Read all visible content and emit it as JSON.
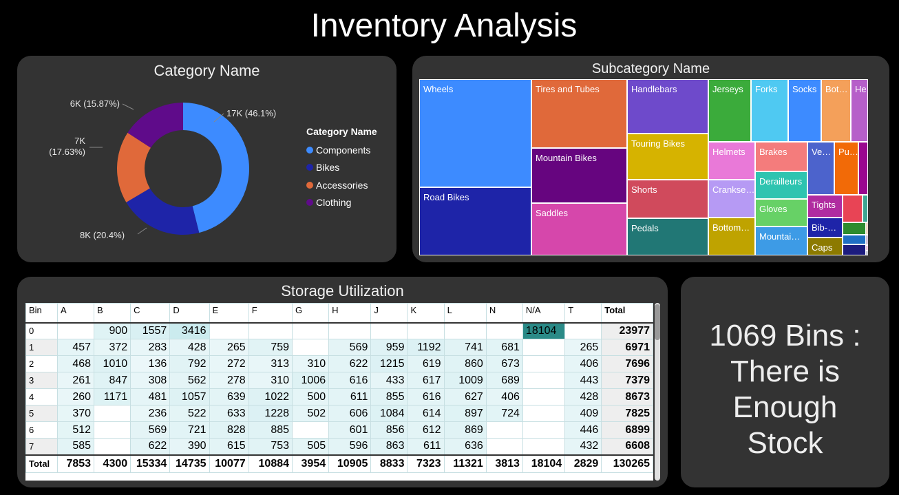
{
  "page": {
    "title": "Inventory Analysis"
  },
  "category_panel": {
    "title": "Category Name",
    "legend_title": "Category Name",
    "legend": [
      {
        "label": "Components",
        "color": "#3D8BFF"
      },
      {
        "label": "Bikes",
        "color": "#1E24A8"
      },
      {
        "label": "Accessories",
        "color": "#E0693A"
      },
      {
        "label": "Clothing",
        "color": "#5F0B8A"
      }
    ]
  },
  "chart_data": {
    "type": "pie",
    "title": "Category Name",
    "slices": [
      {
        "label": "Components",
        "value": 17,
        "percent": 46.1,
        "data_label": "17K (46.1%)",
        "color": "#3D8BFF"
      },
      {
        "label": "Bikes",
        "value": 8,
        "percent": 20.4,
        "data_label": "8K (20.4%)",
        "color": "#1E24A8"
      },
      {
        "label": "Accessories",
        "value": 7,
        "percent": 17.63,
        "data_label_lines": [
          "7K",
          "(17.63%)"
        ],
        "color": "#E0693A"
      },
      {
        "label": "Clothing",
        "value": 6,
        "percent": 15.87,
        "data_label": "6K (15.87%)",
        "color": "#5F0B8A"
      }
    ],
    "legend_position": "right"
  },
  "subcategory_panel": {
    "title": "Subcategory Name",
    "tiles": [
      {
        "id": "wheels",
        "label": "Wheels",
        "color": "#3D8BFF"
      },
      {
        "id": "road-bikes",
        "label": "Road Bikes",
        "color": "#1E24A8"
      },
      {
        "id": "tires",
        "label": "Tires and Tubes",
        "color": "#E0693A"
      },
      {
        "id": "mountain-bikes",
        "label": "Mountain Bikes",
        "color": "#66057F"
      },
      {
        "id": "saddles",
        "label": "Saddles",
        "color": "#D647AB"
      },
      {
        "id": "handlebars",
        "label": "Handlebars",
        "color": "#6E4ACB"
      },
      {
        "id": "touring-bikes",
        "label": "Touring Bikes",
        "color": "#D6B300"
      },
      {
        "id": "shorts",
        "label": "Shorts",
        "color": "#D04A5C"
      },
      {
        "id": "pedals",
        "label": "Pedals",
        "color": "#217775"
      },
      {
        "id": "jerseys",
        "label": "Jerseys",
        "color": "#3BAB3B"
      },
      {
        "id": "forks",
        "label": "Forks",
        "color": "#4FC9F2"
      },
      {
        "id": "socks",
        "label": "Socks",
        "color": "#3D8BFF"
      },
      {
        "id": "bottles",
        "label": "Bot…",
        "color": "#F4A05A"
      },
      {
        "id": "headsets",
        "label": "He…",
        "color": "#B65FC9"
      },
      {
        "id": "helmets",
        "label": "Helmets",
        "color": "#E979D8"
      },
      {
        "id": "cranksets",
        "label": "Crankse…",
        "color": "#B69AF4"
      },
      {
        "id": "bottom-brackets",
        "label": "Bottom…",
        "color": "#BFA300"
      },
      {
        "id": "brakes",
        "label": "Brakes",
        "color": "#F47C7C"
      },
      {
        "id": "derailleurs",
        "label": "Derailleurs",
        "color": "#2EC4B0"
      },
      {
        "id": "gloves",
        "label": "Gloves",
        "color": "#67D166"
      },
      {
        "id": "mountain-frames",
        "label": "Mountai…",
        "color": "#3D9BE6"
      },
      {
        "id": "vests",
        "label": "Ve…",
        "color": "#4C63CC"
      },
      {
        "id": "pumps",
        "label": "Pu…",
        "color": "#F26A07"
      },
      {
        "id": "purple-small",
        "label": "",
        "color": "#9A078F"
      },
      {
        "id": "tights",
        "label": "Tights",
        "color": "#B02CA0"
      },
      {
        "id": "bib-shorts",
        "label": "Bib-…",
        "color": "#1E24A8"
      },
      {
        "id": "caps",
        "label": "Caps",
        "color": "#8C7A00"
      },
      {
        "id": "red-small",
        "label": "",
        "color": "#E84455"
      },
      {
        "id": "teal-small",
        "label": "",
        "color": "#3EA592"
      },
      {
        "id": "green-small",
        "label": "",
        "color": "#2E8B2E"
      },
      {
        "id": "orange-small",
        "label": "",
        "color": "#D06020"
      },
      {
        "id": "blue-small",
        "label": "",
        "color": "#1F6FC4"
      },
      {
        "id": "navy-small",
        "label": "",
        "color": "#1C1C7E"
      },
      {
        "id": "purple-tiny",
        "label": "",
        "color": "#55126C"
      },
      {
        "id": "pink-tiny",
        "label": "",
        "color": "#C4277E"
      },
      {
        "id": "dark-tiny",
        "label": "",
        "color": "#122B4F"
      }
    ]
  },
  "storage": {
    "title": "Storage Utilization",
    "columns": [
      "Bin",
      "A",
      "B",
      "C",
      "D",
      "E",
      "F",
      "G",
      "H",
      "J",
      "K",
      "L",
      "N",
      "N/A",
      "T",
      "Total"
    ],
    "rows": [
      [
        "0",
        "",
        "900",
        "1557",
        "3416",
        "",
        "",
        "",
        "",
        "",
        "",
        "",
        "",
        "18104",
        "",
        "23977"
      ],
      [
        "1",
        "457",
        "372",
        "283",
        "428",
        "265",
        "759",
        "",
        "569",
        "959",
        "1192",
        "741",
        "681",
        "",
        "265",
        "6971"
      ],
      [
        "2",
        "468",
        "1010",
        "136",
        "792",
        "272",
        "313",
        "310",
        "622",
        "1215",
        "619",
        "860",
        "673",
        "",
        "406",
        "7696"
      ],
      [
        "3",
        "261",
        "847",
        "308",
        "562",
        "278",
        "310",
        "1006",
        "616",
        "433",
        "617",
        "1009",
        "689",
        "",
        "443",
        "7379"
      ],
      [
        "4",
        "260",
        "1171",
        "481",
        "1057",
        "639",
        "1022",
        "500",
        "611",
        "855",
        "616",
        "627",
        "406",
        "",
        "428",
        "8673"
      ],
      [
        "5",
        "370",
        "",
        "236",
        "522",
        "633",
        "1228",
        "502",
        "606",
        "1084",
        "614",
        "897",
        "724",
        "",
        "409",
        "7825"
      ],
      [
        "6",
        "512",
        "",
        "569",
        "721",
        "828",
        "885",
        "",
        "601",
        "856",
        "612",
        "869",
        "",
        "",
        "446",
        "6899"
      ],
      [
        "7",
        "585",
        "",
        "622",
        "390",
        "615",
        "753",
        "505",
        "596",
        "863",
        "611",
        "636",
        "",
        "",
        "432",
        "6608"
      ]
    ],
    "total_row": [
      "Total",
      "7853",
      "4300",
      "15334",
      "14735",
      "10077",
      "10884",
      "3954",
      "10905",
      "8833",
      "7323",
      "11321",
      "3813",
      "18104",
      "2829",
      "130265"
    ]
  },
  "kpi": {
    "lines": [
      "1069 Bins :",
      "There is",
      "Enough",
      "Stock"
    ]
  },
  "colors": {
    "background": "#000000",
    "panel": "#333333",
    "heat_low": "#F2FAFB",
    "heat_high": "#2A8A87"
  }
}
